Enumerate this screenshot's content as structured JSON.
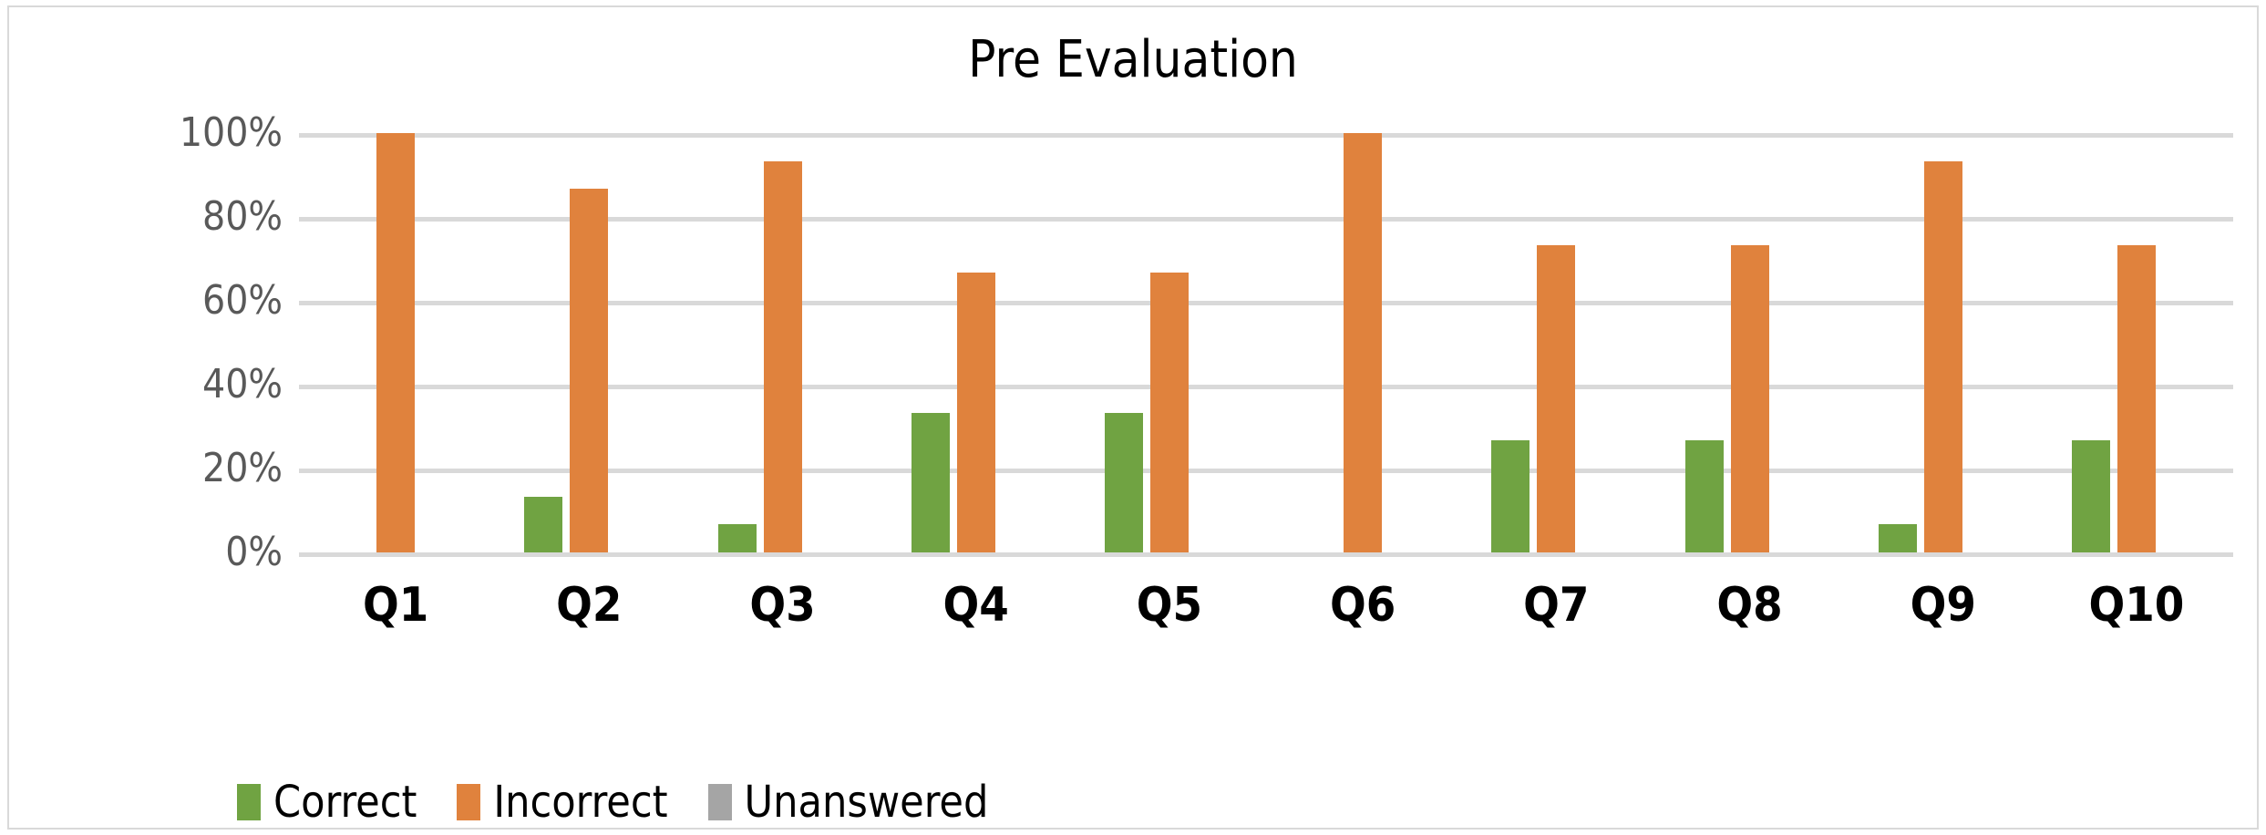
{
  "chart_data": {
    "type": "bar",
    "title": "Pre Evaluation",
    "xlabel": "",
    "ylabel": "",
    "ylim": [
      0,
      100
    ],
    "ytick_labels": [
      "100%",
      "80%",
      "60%",
      "40%",
      "20%",
      "0%"
    ],
    "ytick_values": [
      100,
      80,
      60,
      40,
      20,
      0
    ],
    "grid": true,
    "legend_position": "bottom-left",
    "categories": [
      "Q1",
      "Q2",
      "Q3",
      "Q4",
      "Q5",
      "Q6",
      "Q7",
      "Q8",
      "Q9",
      "Q10"
    ],
    "series": [
      {
        "name": "Correct",
        "color": "#70A342",
        "values": [
          0,
          13.3,
          6.7,
          33.3,
          33.3,
          0,
          26.7,
          26.7,
          6.7,
          26.7
        ]
      },
      {
        "name": "Incorrect",
        "color": "#E0823D",
        "values": [
          100,
          86.7,
          93.3,
          66.7,
          66.7,
          100,
          73.3,
          73.3,
          93.3,
          73.3
        ]
      },
      {
        "name": "Unanswered",
        "color": "#A5A5A5",
        "values": [
          0,
          0,
          0,
          0,
          0,
          0,
          0,
          0,
          0,
          0
        ]
      }
    ]
  },
  "colors": {
    "correct": "#70A342",
    "incorrect": "#E0823D",
    "unanswered": "#A5A5A5",
    "gridline": "#d9d9d9",
    "axis_text": "#595959",
    "border": "#d9d9d9"
  }
}
